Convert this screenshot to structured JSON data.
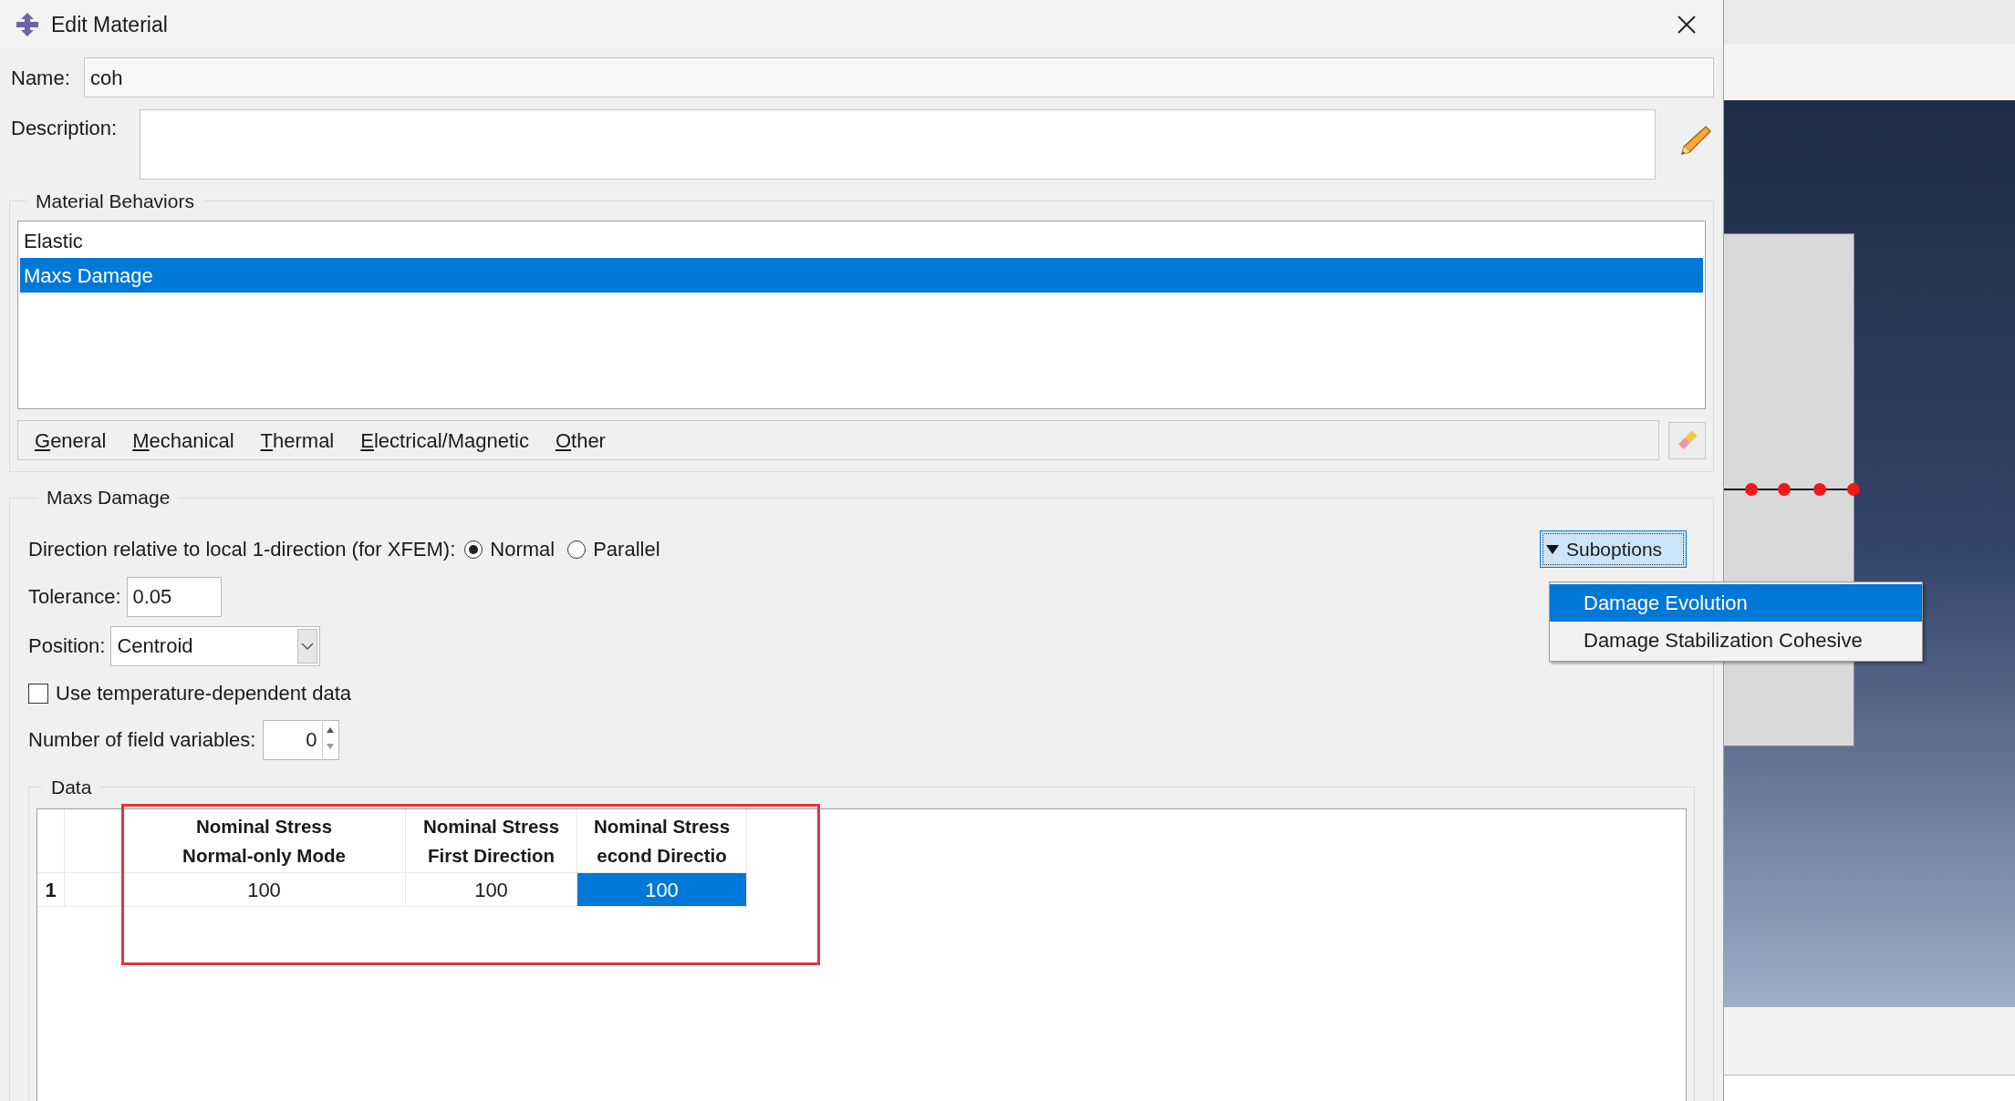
{
  "window": {
    "title": "Edit Material"
  },
  "name": {
    "label": "Name:",
    "value": "coh"
  },
  "description": {
    "label": "Description:"
  },
  "material_behaviors": {
    "title": "Material Behaviors",
    "items": [
      {
        "label": "Elastic",
        "selected": false
      },
      {
        "label": "Maxs Damage",
        "selected": true
      }
    ]
  },
  "menu_bar": [
    "General",
    "Mechanical",
    "Thermal",
    "Electrical/Magnetic",
    "Other"
  ],
  "maxs_damage": {
    "title": "Maxs Damage",
    "direction": {
      "label": "Direction relative to local 1-direction (for XFEM):",
      "options": [
        {
          "label": "Normal",
          "selected": true
        },
        {
          "label": "Parallel",
          "selected": false
        }
      ]
    },
    "suboptions": {
      "label": "Suboptions",
      "menu": [
        {
          "label": "Damage Evolution",
          "selected": true
        },
        {
          "label": "Damage Stabilization Cohesive",
          "selected": false
        }
      ]
    },
    "tolerance": {
      "label": "Tolerance:",
      "value": "0.05"
    },
    "position": {
      "label": "Position:",
      "value": "Centroid"
    },
    "temperature_dependent": {
      "label": "Use temperature-dependent data",
      "checked": false
    },
    "field_variables": {
      "label": "Number of field variables:",
      "value": "0"
    },
    "data": {
      "title": "Data",
      "columns": [
        "Nominal Stress\nNormal-only Mode",
        "Nominal Stress\nFirst Direction",
        "Nominal Stress\necond Directio"
      ],
      "rows": [
        {
          "label": "1",
          "cells": [
            {
              "value": "100",
              "selected": false
            },
            {
              "value": "100",
              "selected": false
            },
            {
              "value": "100",
              "selected": true
            }
          ]
        }
      ]
    }
  }
}
